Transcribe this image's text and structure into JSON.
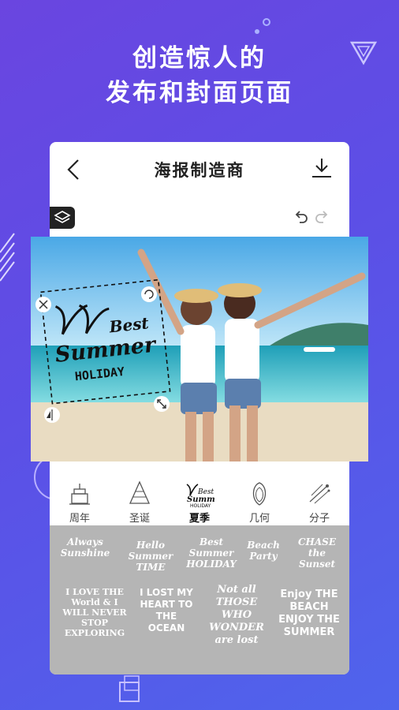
{
  "hero": {
    "line1": "创造惊人的",
    "line2": "发布和封面页面"
  },
  "app": {
    "title": "海报制造商"
  },
  "icons": {
    "back": "chevron-left-icon",
    "download": "download-icon",
    "layers": "layers-icon",
    "undo": "undo-icon",
    "redo": "redo-icon"
  },
  "sticker": {
    "line1": "Best",
    "line2": "Summer",
    "line3": "HOLIDAY"
  },
  "categories": [
    {
      "label": "周年",
      "icon": "cake-icon"
    },
    {
      "label": "圣诞",
      "icon": "christmas-tree-icon"
    },
    {
      "label": "夏季",
      "icon": "summer-palm-icon"
    },
    {
      "label": "几何",
      "icon": "geometric-icon"
    },
    {
      "label": "分子",
      "icon": "molecule-icon"
    }
  ],
  "active_category": "夏季",
  "stickers": [
    {
      "text": "Always Sunshine"
    },
    {
      "text": "Hello Summer TIME"
    },
    {
      "text": "Best Summer HOLIDAY"
    },
    {
      "text": "Beach Party"
    },
    {
      "text": "CHASE the Sunset"
    },
    {
      "text": "I LOVE THE World & I WILL NEVER STOP EXPLORING"
    },
    {
      "text": "I LOST MY HEART TO THE OCEAN"
    },
    {
      "text": "Not all THOSE WHO WONDER are lost"
    },
    {
      "text": "Enjoy THE BEACH ENJOY THE SUMMER"
    }
  ],
  "colors": {
    "bg_start": "#6a45e0",
    "bg_end": "#4f64ec",
    "card": "#ffffff",
    "sticker_panel": "#b5b5b5",
    "text_dark": "#222222"
  }
}
